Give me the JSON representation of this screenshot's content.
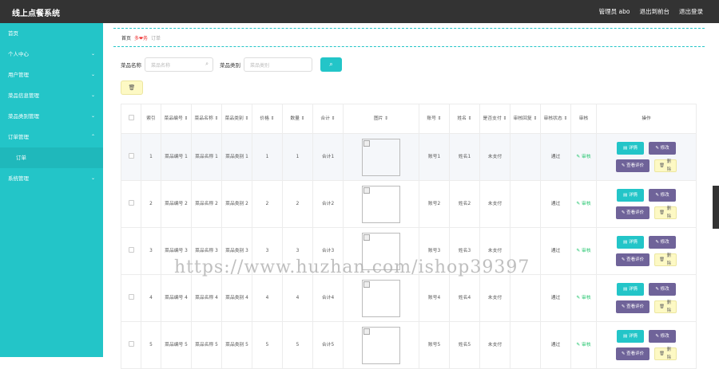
{
  "app": {
    "title": "线上点餐系统",
    "user": "管理员 abo",
    "back_home": "退出到前台",
    "logout": "退出登录"
  },
  "sidebar": {
    "items": [
      {
        "label": "首页",
        "chev": ""
      },
      {
        "label": "个人中心",
        "chev": "⌄"
      },
      {
        "label": "用户管理",
        "chev": "⌄"
      },
      {
        "label": "菜品信息管理",
        "chev": "⌄"
      },
      {
        "label": "菜品类别管理",
        "chev": "⌄"
      },
      {
        "label": "订单管理",
        "chev": "⌃"
      }
    ],
    "subitem": "订单",
    "last": {
      "label": "系统管理",
      "chev": "⌄"
    }
  },
  "breadcrumb": {
    "home": "首页",
    "current": "多❤务",
    "sub": "订单"
  },
  "search": {
    "name_label": "菜品名称",
    "name_placeholder": "菜品名称",
    "type_label": "菜品类别",
    "type_placeholder": "菜品类别",
    "button_icon": "search-icon"
  },
  "toolbar": {
    "delete_icon": "trash-icon"
  },
  "table": {
    "headers": [
      "索引",
      "菜品编号 ⇕",
      "菜品名称 ⇕",
      "菜品类别 ⇕",
      "价格 ⇕",
      "数量 ⇕",
      "合计 ⇕",
      "图片 ⇕",
      "账号 ⇕",
      "姓名 ⇕",
      "是否支付 ⇕",
      "审核回复 ⇕",
      "审核状态 ⇕",
      "审核",
      "操作"
    ],
    "rows": [
      {
        "idx": "1",
        "code": "菜品编号 1",
        "name": "菜品名称 1",
        "type": "菜品类别 1",
        "price": "1",
        "qty": "1",
        "total": "合计1",
        "account": "账号1",
        "person": "姓名1",
        "paid": "未支付",
        "reply": "",
        "status": "通过",
        "audit": "✎ 审核"
      },
      {
        "idx": "2",
        "code": "菜品编号 2",
        "name": "菜品名称 2",
        "type": "菜品类别 2",
        "price": "2",
        "qty": "2",
        "total": "合计2",
        "account": "账号2",
        "person": "姓名2",
        "paid": "未支付",
        "reply": "",
        "status": "通过",
        "audit": "✎ 审核"
      },
      {
        "idx": "3",
        "code": "菜品编号 3",
        "name": "菜品名称 3",
        "type": "菜品类别 3",
        "price": "3",
        "qty": "3",
        "total": "合计3",
        "account": "账号3",
        "person": "姓名3",
        "paid": "未支付",
        "reply": "",
        "status": "通过",
        "audit": "✎ 审核"
      },
      {
        "idx": "4",
        "code": "菜品编号 4",
        "name": "菜品名称 4",
        "type": "菜品类别 4",
        "price": "4",
        "qty": "4",
        "total": "合计4",
        "account": "账号4",
        "person": "姓名4",
        "paid": "未支付",
        "reply": "",
        "status": "通过",
        "audit": "✎ 审核"
      },
      {
        "idx": "5",
        "code": "菜品编号 5",
        "name": "菜品名称 5",
        "type": "菜品类别 5",
        "price": "5",
        "qty": "5",
        "total": "合计5",
        "account": "账号5",
        "person": "姓名5",
        "paid": "未支付",
        "reply": "",
        "status": "通过",
        "audit": "✎ 审核"
      }
    ],
    "actions": {
      "view": "详情",
      "edit": "修改",
      "review": "查看评价",
      "delete": "删除"
    }
  },
  "watermark": "https://www.huzhan.com/ishop39397",
  "colors": {
    "accent": "#23c5c8",
    "topbar": "#333333",
    "purple": "#6f6399",
    "yellow": "#fdf9c4"
  }
}
